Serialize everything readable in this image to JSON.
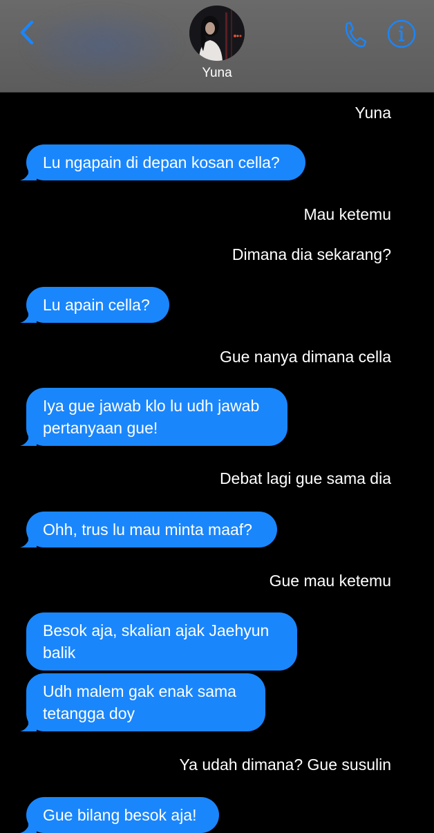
{
  "header": {
    "contact_name": "Yuna",
    "back_icon": "chevron-left-icon",
    "call_icon": "phone-icon",
    "info_icon": "info-circle-icon",
    "accent_color": "#1a86fc"
  },
  "messages": [
    {
      "type": "narration",
      "text": "Yuna"
    },
    {
      "type": "bubble",
      "text": "Lu ngapain di depan kosan cella?"
    },
    {
      "type": "narration",
      "text": "Mau ketemu"
    },
    {
      "type": "narration",
      "text": "Dimana dia sekarang?"
    },
    {
      "type": "bubble",
      "text": "Lu apain cella?"
    },
    {
      "type": "narration",
      "text": "Gue nanya dimana cella"
    },
    {
      "type": "bubble",
      "text": "Iya gue jawab klo lu udh jawab pertanyaan gue!"
    },
    {
      "type": "narration",
      "text": "Debat lagi gue sama dia"
    },
    {
      "type": "bubble",
      "text": "Ohh, trus lu mau minta maaf?"
    },
    {
      "type": "narration",
      "text": "Gue mau ketemu"
    },
    {
      "type": "bubble",
      "text": "Besok aja, skalian ajak Jaehyun balik"
    },
    {
      "type": "bubble",
      "text": "Udh malem gak enak sama tetangga doy"
    },
    {
      "type": "narration",
      "text": "Ya udah dimana? Gue susulin"
    },
    {
      "type": "bubble",
      "text": "Gue bilang besok aja!"
    }
  ]
}
